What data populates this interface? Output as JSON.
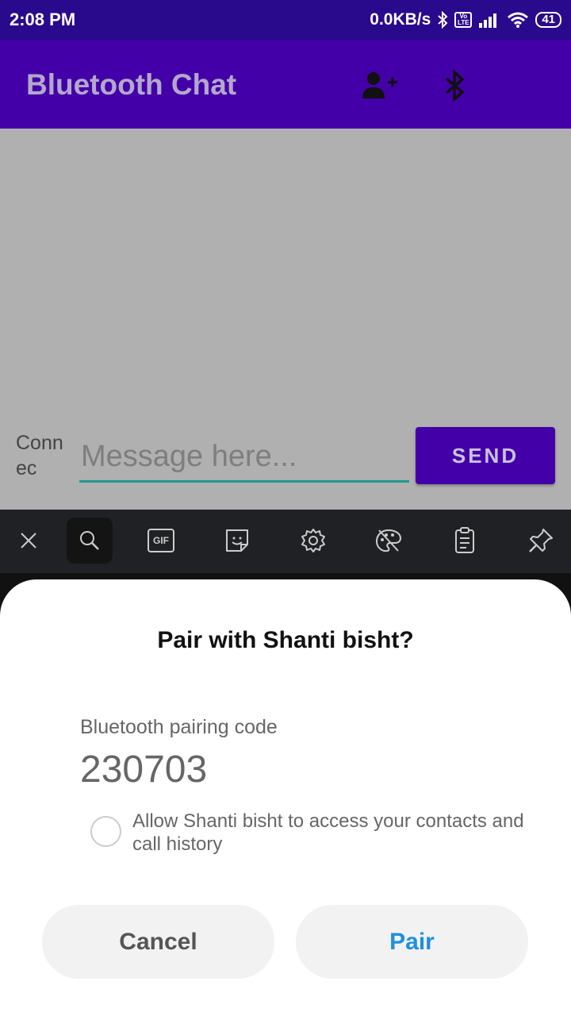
{
  "status_bar": {
    "time": "2:08 PM",
    "net_speed": "0.0KB/s",
    "network_badge": "Vo LTE",
    "battery": "41"
  },
  "app_bar": {
    "title": "Bluetooth Chat",
    "icons": [
      "add-person-icon",
      "bluetooth-icon"
    ]
  },
  "chat": {
    "connection_status": "Connec",
    "message_placeholder": "Message here...",
    "send_label": "SEND"
  },
  "keyboard_toolbar": {
    "items": [
      "close-icon",
      "search-icon",
      "gif-icon",
      "sticker-icon",
      "settings-icon",
      "theme-icon",
      "clipboard-icon",
      "pin-icon"
    ],
    "gif_label": "GIF"
  },
  "dialog": {
    "title": "Pair with Shanti bisht?",
    "code_label": "Bluetooth pairing code",
    "code": "230703",
    "allow_text": "Allow Shanti bisht to access your contacts and call history",
    "cancel_label": "Cancel",
    "pair_label": "Pair"
  },
  "colors": {
    "status_bar": "#2a0a8c",
    "primary": "#4400a8",
    "accent_underline": "#1f9a8e",
    "pair_blue": "#1e8fe0"
  }
}
